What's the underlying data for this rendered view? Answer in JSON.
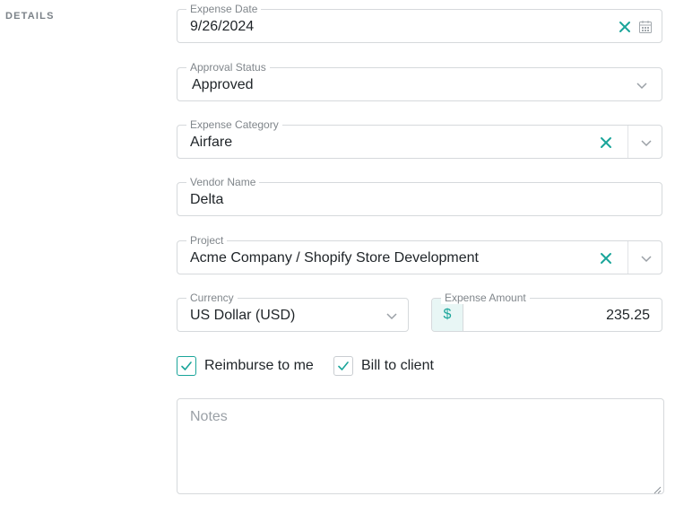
{
  "section": {
    "label": "DETAILS"
  },
  "expense_date": {
    "label": "Expense Date",
    "value": "9/26/2024"
  },
  "approval_status": {
    "label": "Approval Status",
    "value": "Approved"
  },
  "expense_category": {
    "label": "Expense Category",
    "value": "Airfare"
  },
  "vendor_name": {
    "label": "Vendor Name",
    "value": "Delta"
  },
  "project": {
    "label": "Project",
    "value": "Acme Company / Shopify Store Development"
  },
  "currency": {
    "label": "Currency",
    "value": "US Dollar (USD)"
  },
  "expense_amount": {
    "label": "Expense Amount",
    "currency_symbol": "$",
    "value": "235.25"
  },
  "checkboxes": {
    "reimburse": {
      "label": "Reimburse to me",
      "checked": true
    },
    "bill_client": {
      "label": "Bill to client",
      "checked": true
    }
  },
  "notes": {
    "placeholder": "Notes",
    "value": ""
  },
  "colors": {
    "accent": "#1aa59a",
    "border": "#d6d9dc",
    "label": "#80868b"
  },
  "icons": [
    "clear-icon",
    "calendar-icon",
    "chevron-down-icon",
    "checkmark-icon",
    "resize-handle-icon"
  ]
}
